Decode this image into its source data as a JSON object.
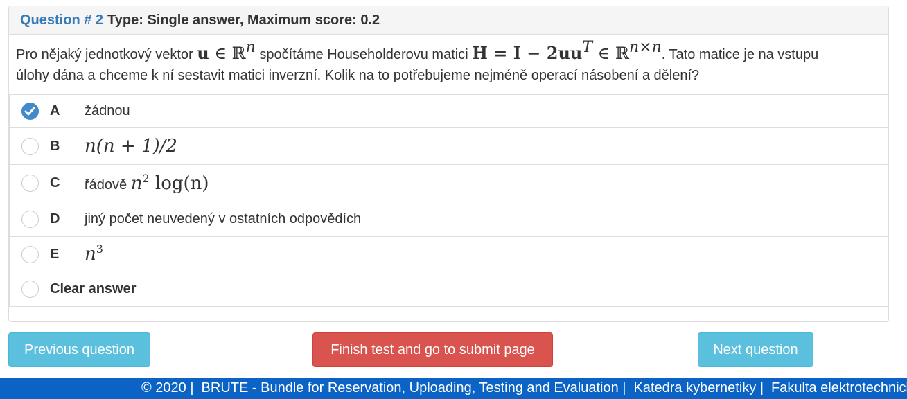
{
  "question": {
    "number_label": "Question # 2",
    "type_label": "Type: Single answer, Maximum score: 0.2",
    "text_parts": {
      "p1": "Pro nějaký jednotkový vektor ",
      "math_u": "u",
      "math_in1": " ∈ ℝ",
      "math_n": "n",
      "p2": " spočítáme Householderovu matici ",
      "math_H": "H = I − 2uu",
      "math_T": "T",
      "math_in2": " ∈ ℝ",
      "math_nxn": "n×n",
      "p3": ". Tato matice je na vstupu",
      "p4": "úlohy dána a chceme k ní sestavit matici inverzní. Kolik na to potřebujeme nejméně operací násobení a dělení?"
    }
  },
  "options": [
    {
      "letter": "A",
      "text": "žádnou",
      "selected": true
    },
    {
      "letter": "B",
      "text": "n(n + 1)/2",
      "selected": false
    },
    {
      "letter": "C",
      "prefix": "řádově ",
      "text": "n",
      "sup": "2",
      "suffix": " log(n)",
      "selected": false
    },
    {
      "letter": "D",
      "text": "jiný počet neuvedený v ostatních odpovědích",
      "selected": false
    },
    {
      "letter": "E",
      "text": "n",
      "sup": "3",
      "selected": false
    }
  ],
  "clear_label": "Clear answer",
  "buttons": {
    "previous": "Previous question",
    "finish": "Finish test and go to submit page",
    "next": "Next question"
  },
  "footer": {
    "copyright": "© 2020 |",
    "brute": "BRUTE - Bundle for Reservation, Uploading, Testing and Evaluation |",
    "dept": "Katedra kybernetiky |",
    "faculty": "Fakulta elektrotechnická"
  },
  "colors": {
    "primary": "#337ab7",
    "info": "#5bc0de",
    "danger": "#d9534f",
    "footer": "#0b63c5",
    "checked": "#428bca"
  }
}
